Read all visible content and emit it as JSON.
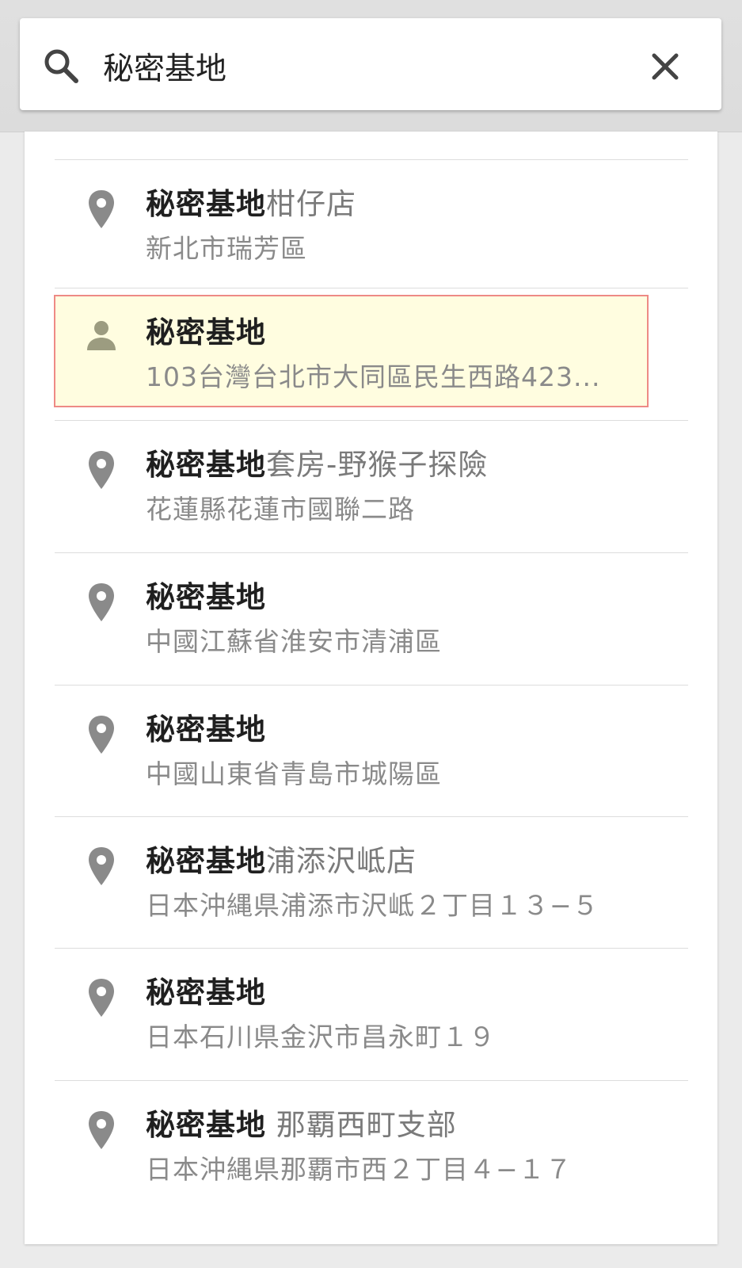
{
  "search": {
    "query": "秘密基地",
    "placeholder": ""
  },
  "results": [
    {
      "icon": "map-pin-icon",
      "title_bold": "秘密基地",
      "title_rest": "柑仔店",
      "subtitle": "新北市瑞芳區",
      "highlighted": false
    },
    {
      "icon": "person-icon",
      "title_bold": "秘密基地",
      "title_rest": "",
      "subtitle": "103台灣台北市大同區民生西路423...",
      "highlighted": true
    },
    {
      "icon": "map-pin-icon",
      "title_bold": "秘密基地",
      "title_rest": "套房-野猴子探險",
      "subtitle": "花蓮縣花蓮市國聯二路",
      "highlighted": false
    },
    {
      "icon": "map-pin-icon",
      "title_bold": "秘密基地",
      "title_rest": "",
      "subtitle": "中國江蘇省淮安市清浦區",
      "highlighted": false
    },
    {
      "icon": "map-pin-icon",
      "title_bold": "秘密基地",
      "title_rest": "",
      "subtitle": "中國山東省青島市城陽區",
      "highlighted": false
    },
    {
      "icon": "map-pin-icon",
      "title_bold": "秘密基地",
      "title_rest": "浦添沢岻店",
      "subtitle": "日本沖縄県浦添市沢岻２丁目１３−５",
      "highlighted": false
    },
    {
      "icon": "map-pin-icon",
      "title_bold": "秘密基地",
      "title_rest": "",
      "subtitle": "日本石川県金沢市昌永町１９",
      "highlighted": false
    },
    {
      "icon": "map-pin-icon",
      "title_bold": "秘密基地",
      "title_rest": " 那覇西町支部",
      "subtitle": "日本沖縄県那覇市西２丁目４−１７",
      "highlighted": false
    }
  ],
  "colors": {
    "highlight_fill": "#fffde0",
    "highlight_border": "#ee8a85",
    "pin_gray": "#8a8a8a",
    "person_olive": "#9c9c80"
  }
}
